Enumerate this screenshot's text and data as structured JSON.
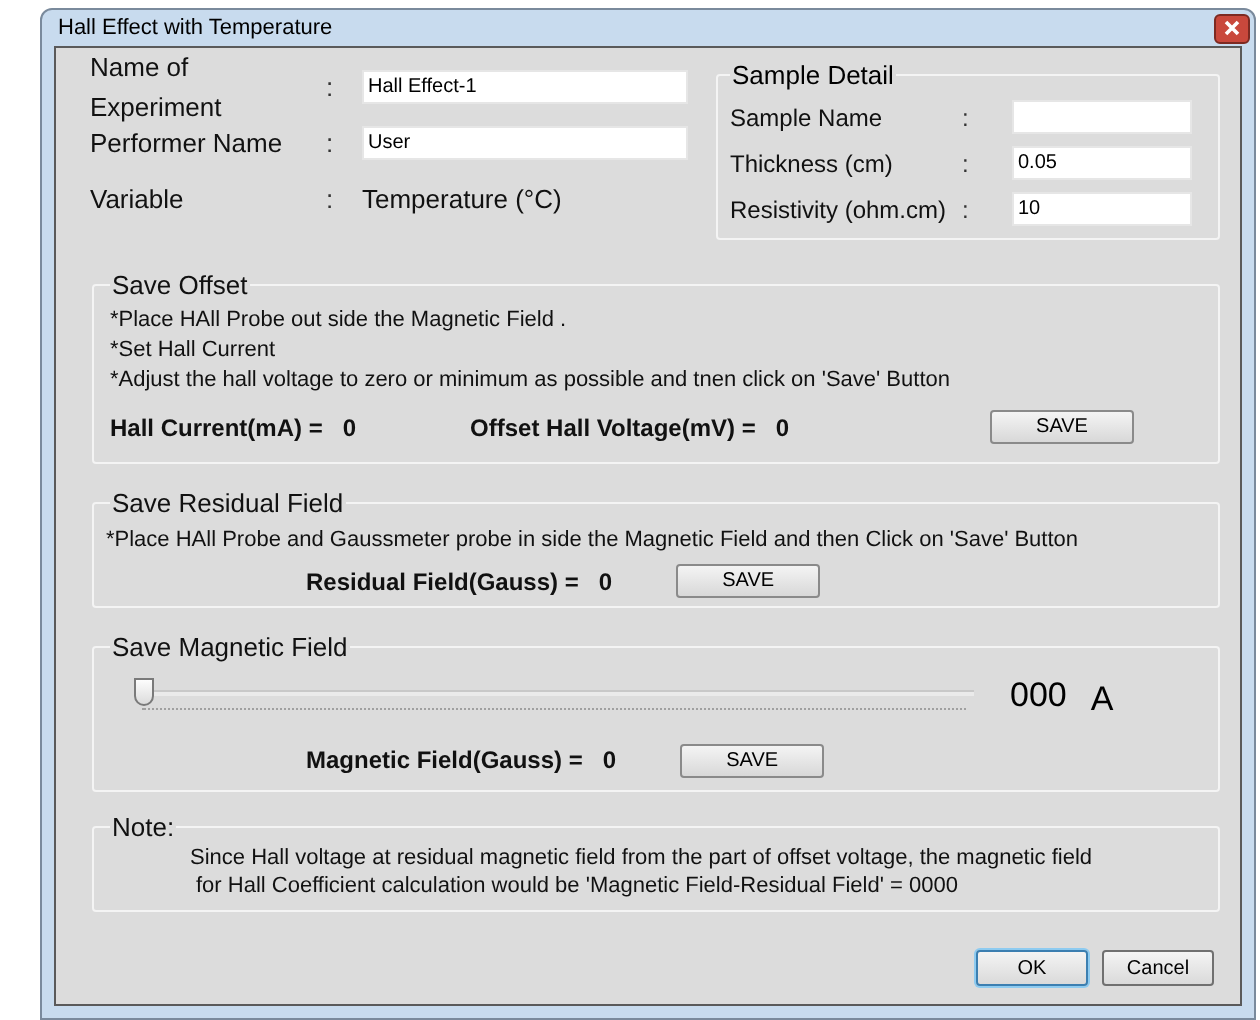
{
  "window": {
    "title": "Hall Effect with Temperature"
  },
  "experiment": {
    "fields": [
      {
        "kind": "input",
        "label": "Name of Experiment",
        "colon": ":",
        "value": "Hall Effect-1"
      },
      {
        "kind": "input",
        "label": "Performer Name",
        "colon": ":",
        "value": "User"
      },
      {
        "kind": "text",
        "label": "Variable",
        "colon": ":",
        "value": "Temperature (°C)"
      }
    ]
  },
  "sample_detail": {
    "title": "Sample Detail",
    "fields": [
      {
        "label": "Sample Name",
        "colon": ":"
      },
      {
        "label": "Thickness (cm)",
        "colon": ":",
        "value": "0.05"
      },
      {
        "label": "Resistivity (ohm.cm)",
        "colon": ":",
        "value": "10"
      }
    ]
  },
  "save_offset": {
    "title": "Save Offset",
    "instructions": [
      "*Place HAll Probe out side the Magnetic Field .",
      "*Set Hall Current",
      "*Adjust the hall voltage to zero or minimum as possible and tnen click on 'Save' Button"
    ],
    "readings": [
      {
        "label": "Hall Current(mA) =",
        "value": "0"
      },
      {
        "label": "Offset Hall Voltage(mV) =",
        "value": "0"
      }
    ],
    "button": "SAVE"
  },
  "save_residual_field": {
    "title": "Save Residual Field",
    "instructions": [
      "*Place HAll Probe and Gaussmeter probe in side  the Magnetic Field  and then Click on 'Save' Button"
    ],
    "readings": [
      {
        "label": "Residual Field(Gauss) =",
        "value": "0"
      }
    ],
    "button": "SAVE"
  },
  "save_magnetic_field": {
    "title": "Save Magnetic Field",
    "slider": {
      "level": 0
    },
    "readout": "000",
    "unit": "A",
    "readings": [
      {
        "label": "Magnetic Field(Gauss) =",
        "value": "0"
      }
    ],
    "button": "SAVE"
  },
  "note": {
    "title": "Note:",
    "lines": [
      "Since Hall voltage at residual magnetic field from the part of offset voltage, the magnetic field",
      "for Hall Coefficient calculation would be 'Magnetic Field-Residual Field' =  0000"
    ]
  },
  "buttons": [
    {
      "label": "OK",
      "default": true
    },
    {
      "label": "Cancel",
      "default": false
    }
  ]
}
